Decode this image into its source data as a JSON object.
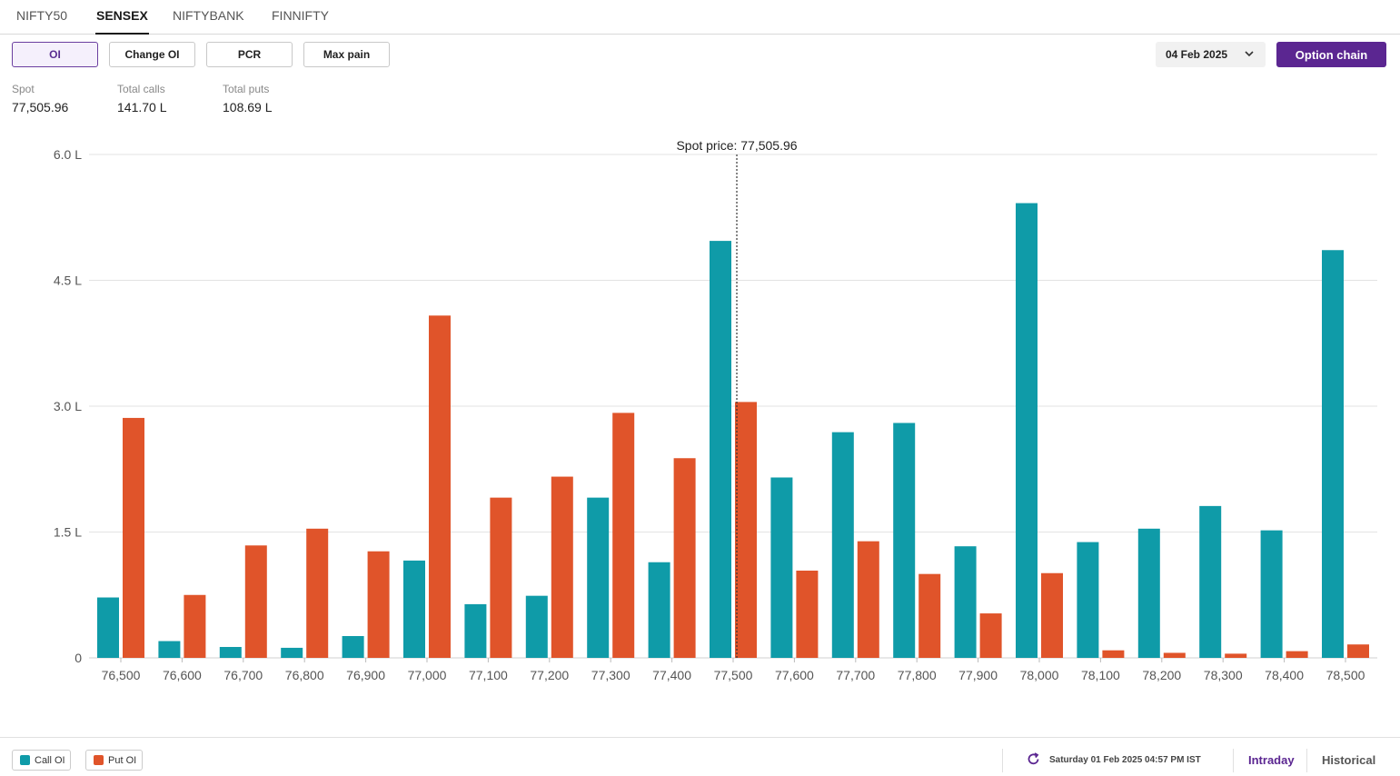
{
  "tabs": [
    "NIFTY50",
    "SENSEX",
    "NIFTYBANK",
    "FINNIFTY"
  ],
  "active_tab": "SENSEX",
  "toolbar": {
    "buttons": [
      "OI",
      "Change OI",
      "PCR",
      "Max pain"
    ],
    "active_button": "OI",
    "expiry_date": "04 Feb 2025",
    "option_chain_label": "Option chain"
  },
  "stats": {
    "spot_label": "Spot",
    "spot_value": "77,505.96",
    "calls_label": "Total calls",
    "calls_value": "141.70 L",
    "puts_label": "Total puts",
    "puts_value": "108.69 L"
  },
  "colors": {
    "call": "#0f9ba8",
    "put": "#e0542a",
    "accent": "#5b2691"
  },
  "chart_data": {
    "type": "bar",
    "spot_annotation": "Spot price: 77,505.96",
    "spot_x": 77505.96,
    "categories": [
      "76,500",
      "76,600",
      "76,700",
      "76,800",
      "76,900",
      "77,000",
      "77,100",
      "77,200",
      "77,300",
      "77,400",
      "77,500",
      "77,600",
      "77,700",
      "77,800",
      "77,900",
      "78,000",
      "78,100",
      "78,200",
      "78,300",
      "78,400",
      "78,500"
    ],
    "strikes": [
      76500,
      76600,
      76700,
      76800,
      76900,
      77000,
      77100,
      77200,
      77300,
      77400,
      77500,
      77600,
      77700,
      77800,
      77900,
      78000,
      78100,
      78200,
      78300,
      78400,
      78500
    ],
    "y_ticks": [
      "0",
      "1.5 L",
      "3.0 L",
      "4.5 L",
      "6.0 L"
    ],
    "ylim": [
      0,
      6.0
    ],
    "grid": true,
    "series": [
      {
        "name": "Call OI",
        "values": [
          0.72,
          0.2,
          0.13,
          0.12,
          0.26,
          1.16,
          0.64,
          0.74,
          1.91,
          1.14,
          4.97,
          2.15,
          2.69,
          2.8,
          1.33,
          5.42,
          1.38,
          1.54,
          1.81,
          1.52,
          4.86
        ]
      },
      {
        "name": "Put OI",
        "values": [
          2.86,
          0.75,
          1.34,
          1.54,
          1.27,
          4.08,
          1.91,
          2.16,
          2.92,
          2.38,
          3.05,
          1.04,
          1.39,
          1.0,
          0.53,
          1.01,
          0.09,
          0.06,
          0.05,
          0.08,
          0.16
        ]
      }
    ]
  },
  "footer": {
    "timestamp": "Saturday 01 Feb 2025 04:57 PM IST",
    "intraday": "Intraday",
    "historical": "Historical"
  }
}
